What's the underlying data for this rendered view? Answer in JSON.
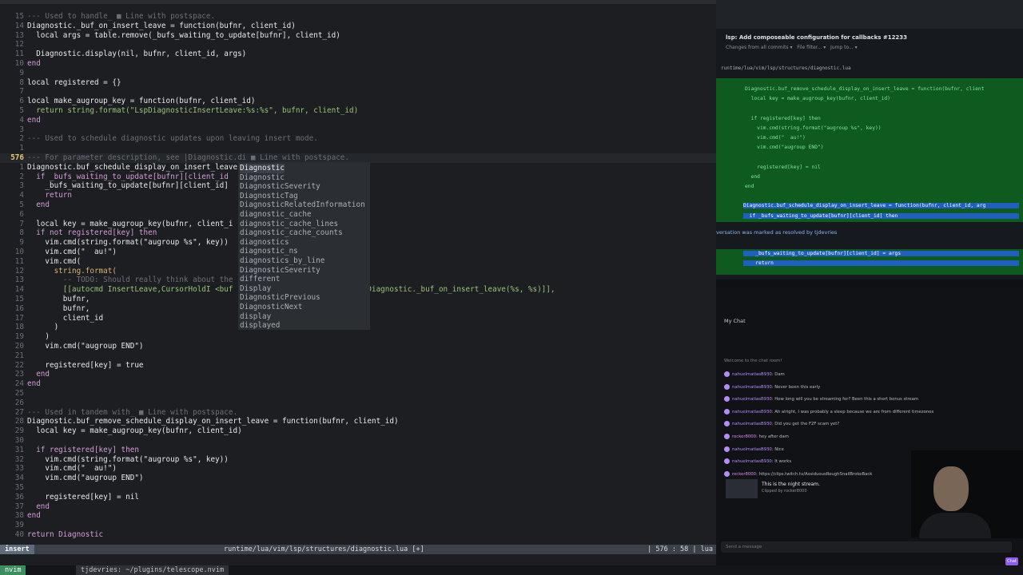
{
  "editor": {
    "lines": [
      {
        "n": "15",
        "text": "--- Used to handle_ ■ Line with postspace.",
        "cls": "cmt"
      },
      {
        "n": "14",
        "text": "Diagnostic._buf_on_insert_leave = function(bufnr, client_id)",
        "cls": "id"
      },
      {
        "n": "13",
        "text": "  local args = table.remove(_bufs_waiting_to_update[bufnr], client_id)",
        "cls": "id"
      },
      {
        "n": "12",
        "text": "",
        "cls": "id"
      },
      {
        "n": "11",
        "text": "  Diagnostic.display(nil, bufnr, client_id, args)",
        "cls": "id"
      },
      {
        "n": "10",
        "text": "end",
        "cls": "kw"
      },
      {
        "n": "9",
        "text": "",
        "cls": "id"
      },
      {
        "n": "8",
        "text": "local registered = {}",
        "cls": "id"
      },
      {
        "n": "7",
        "text": "",
        "cls": "id"
      },
      {
        "n": "6",
        "text": "local make_augroup_key = function(bufnr, client_id)",
        "cls": "id"
      },
      {
        "n": "5",
        "text": "  return string.format(\"LspDiagnosticInsertLeave:%s:%s\", bufnr, client_id)",
        "cls": "str"
      },
      {
        "n": "4",
        "text": "end",
        "cls": "kw"
      },
      {
        "n": "3",
        "text": "",
        "cls": "id"
      },
      {
        "n": "2",
        "text": "--- Used to schedule diagnostic updates upon leaving insert mode.",
        "cls": "cmt"
      },
      {
        "n": "1",
        "text": "",
        "cls": "id"
      },
      {
        "n": "576",
        "text": "--- For parameter description, see |Diagnostic.di ■ Line with postspace.",
        "cls": "cmt",
        "cur": true
      },
      {
        "n": "1",
        "text": "Diagnostic.buf_schedule_display_on_insert_leave                        args)",
        "cls": "id"
      },
      {
        "n": "2",
        "text": "  if _bufs_waiting_to_update[bufnr][client_id",
        "cls": "kw"
      },
      {
        "n": "3",
        "text": "    _bufs_waiting_to_update[bufnr][client_id]",
        "cls": "id"
      },
      {
        "n": "4",
        "text": "    return",
        "cls": "kw"
      },
      {
        "n": "5",
        "text": "  end",
        "cls": "kw"
      },
      {
        "n": "6",
        "text": "",
        "cls": "id"
      },
      {
        "n": "7",
        "text": "  local key = make_augroup_key(bufnr, client_i",
        "cls": "id"
      },
      {
        "n": "8",
        "text": "  if not registered[key] then",
        "cls": "kw"
      },
      {
        "n": "9",
        "text": "    vim.cmd(string.format(\"augroup %s\", key))",
        "cls": "id"
      },
      {
        "n": "10",
        "text": "    vim.cmd(\"  au!\")",
        "cls": "id"
      },
      {
        "n": "11",
        "text": "    vim.cmd(",
        "cls": "id"
      },
      {
        "n": "12",
        "text": "      string.format(",
        "cls": "fn"
      },
      {
        "n": "13",
        "text": "        -- TODO: Should really think about the",
        "cls": "cmt"
      },
      {
        "n": "14",
        "text": "        [[autocmd InsertLeave,CursorHoldI <buf                 structures\").Diagnostic._buf_on_insert_leave(%s, %s)]],",
        "cls": "str"
      },
      {
        "n": "15",
        "text": "        bufnr,",
        "cls": "id"
      },
      {
        "n": "16",
        "text": "        bufnr,",
        "cls": "id"
      },
      {
        "n": "17",
        "text": "        client_id",
        "cls": "id"
      },
      {
        "n": "18",
        "text": "      )",
        "cls": "id"
      },
      {
        "n": "19",
        "text": "    )",
        "cls": "id"
      },
      {
        "n": "20",
        "text": "    vim.cmd(\"augroup END\")",
        "cls": "id"
      },
      {
        "n": "21",
        "text": "",
        "cls": "id"
      },
      {
        "n": "22",
        "text": "    registered[key] = true",
        "cls": "id"
      },
      {
        "n": "23",
        "text": "  end",
        "cls": "kw"
      },
      {
        "n": "24",
        "text": "end",
        "cls": "kw"
      },
      {
        "n": "25",
        "text": "",
        "cls": "id"
      },
      {
        "n": "26",
        "text": "",
        "cls": "id"
      },
      {
        "n": "27",
        "text": "--- Used in tandem with_ ■ Line with postspace.",
        "cls": "cmt"
      },
      {
        "n": "28",
        "text": "Diagnostic.buf_remove_schedule_display_on_insert_leave = function(bufnr, client_id)",
        "cls": "id"
      },
      {
        "n": "29",
        "text": "  local key = make_augroup_key(bufnr, client_id)",
        "cls": "id"
      },
      {
        "n": "30",
        "text": "",
        "cls": "id"
      },
      {
        "n": "31",
        "text": "  if registered[key] then",
        "cls": "kw"
      },
      {
        "n": "32",
        "text": "    vim.cmd(string.format(\"augroup %s\", key))",
        "cls": "id"
      },
      {
        "n": "33",
        "text": "    vim.cmd(\"  au!\")",
        "cls": "id"
      },
      {
        "n": "34",
        "text": "    vim.cmd(\"augroup END\")",
        "cls": "id"
      },
      {
        "n": "35",
        "text": "",
        "cls": "id"
      },
      {
        "n": "36",
        "text": "    registered[key] = nil",
        "cls": "id"
      },
      {
        "n": "37",
        "text": "  end",
        "cls": "kw"
      },
      {
        "n": "38",
        "text": "end",
        "cls": "kw"
      },
      {
        "n": "39",
        "text": "",
        "cls": "id"
      },
      {
        "n": "40",
        "text": "return Diagnostic",
        "cls": "kw"
      }
    ],
    "completion": [
      "Diagnostic",
      "Diagnostic",
      "DiagnosticSeverity",
      "DiagnosticTag",
      "DiagnosticRelatedInformation",
      "diagnostic_cache",
      "diagnostic_cache_lines",
      "diagnostic_cache_counts",
      "diagnostics",
      "diagnostic_ns",
      "diagnostics_by_line",
      "DiagnosticSeverity",
      "different",
      "Display",
      "DiagnosticPrevious",
      "DiagnosticNext",
      "display",
      "displayed"
    ],
    "status": {
      "mode": "insert",
      "file": "runtime/lua/vim/lsp/structures/diagnostic.lua [+]",
      "pos": "| 576 : 58 | lua"
    }
  },
  "tmux": {
    "tab1": "nvim",
    "tab2": "",
    "tab3": "tjdevries: ~/plugins/telescope.nvim"
  },
  "github": {
    "title": "lsp: Add composeable configuration for callbacks #12233",
    "sub": "Changes from all commits ▾   File filter... ▾   Jump to... ▾",
    "path": "runtime/lua/vim/lsp/structures/diagnostic.lua",
    "diff": [
      "Diagnostic.buf_remove_schedule_display_on_insert_leave = function(bufnr, client",
      "  local key = make_augroup_key(bufnr, client_id)",
      "",
      "  if registered[key] then",
      "    vim.cmd(string.format(\"augroup %s\", key))",
      "    vim.cmd(\"  au!\")",
      "    vim.cmd(\"augroup END\")",
      "",
      "    registered[key] = nil",
      "  end",
      "end",
      "",
      "Diagnostic.buf_schedule_display_on_insert_leave = function(bufnr, client_id, arg",
      "  if _bufs_waiting_to_update[bufnr][client_id] then"
    ],
    "banner": "versation was marked as resolved by tjdevries",
    "diff2": [
      "    _bufs_waiting_to_update[bufnr][client_id] = args",
      "    return"
    ]
  },
  "chat": {
    "header": "My Chat",
    "welcome": "Welcome to the chat room!",
    "messages": [
      {
        "user": "nahuelmatiasB930",
        "text": "Dam"
      },
      {
        "user": "nahuelmatiasB930",
        "text": "Never been this early"
      },
      {
        "user": "nahuelmatiasB930",
        "text": "How long will you be streaming for? Been this a short bonus stream"
      },
      {
        "user": "nahuelmatiasB930",
        "text": "Ah alright, I was probably a sleep because we are from different timezones"
      },
      {
        "user": "nahuelmatiasB930",
        "text": "Did you get the F2F scam yet?"
      },
      {
        "user": "rocker8000",
        "text": "hey after dam"
      },
      {
        "user": "nahuelmatiasB930",
        "text": "Nice"
      },
      {
        "user": "nahuelmatiasB930",
        "text": "It works"
      },
      {
        "user": "rocker8000",
        "text": "https://clips.twitch.tv/AssiduousRoughSnailBrokeBack"
      }
    ],
    "clip_title": "This is the night stream.",
    "clip_sub": "Clipped by rocker8000",
    "input_placeholder": "Send a message",
    "chat_button": "Chat"
  }
}
